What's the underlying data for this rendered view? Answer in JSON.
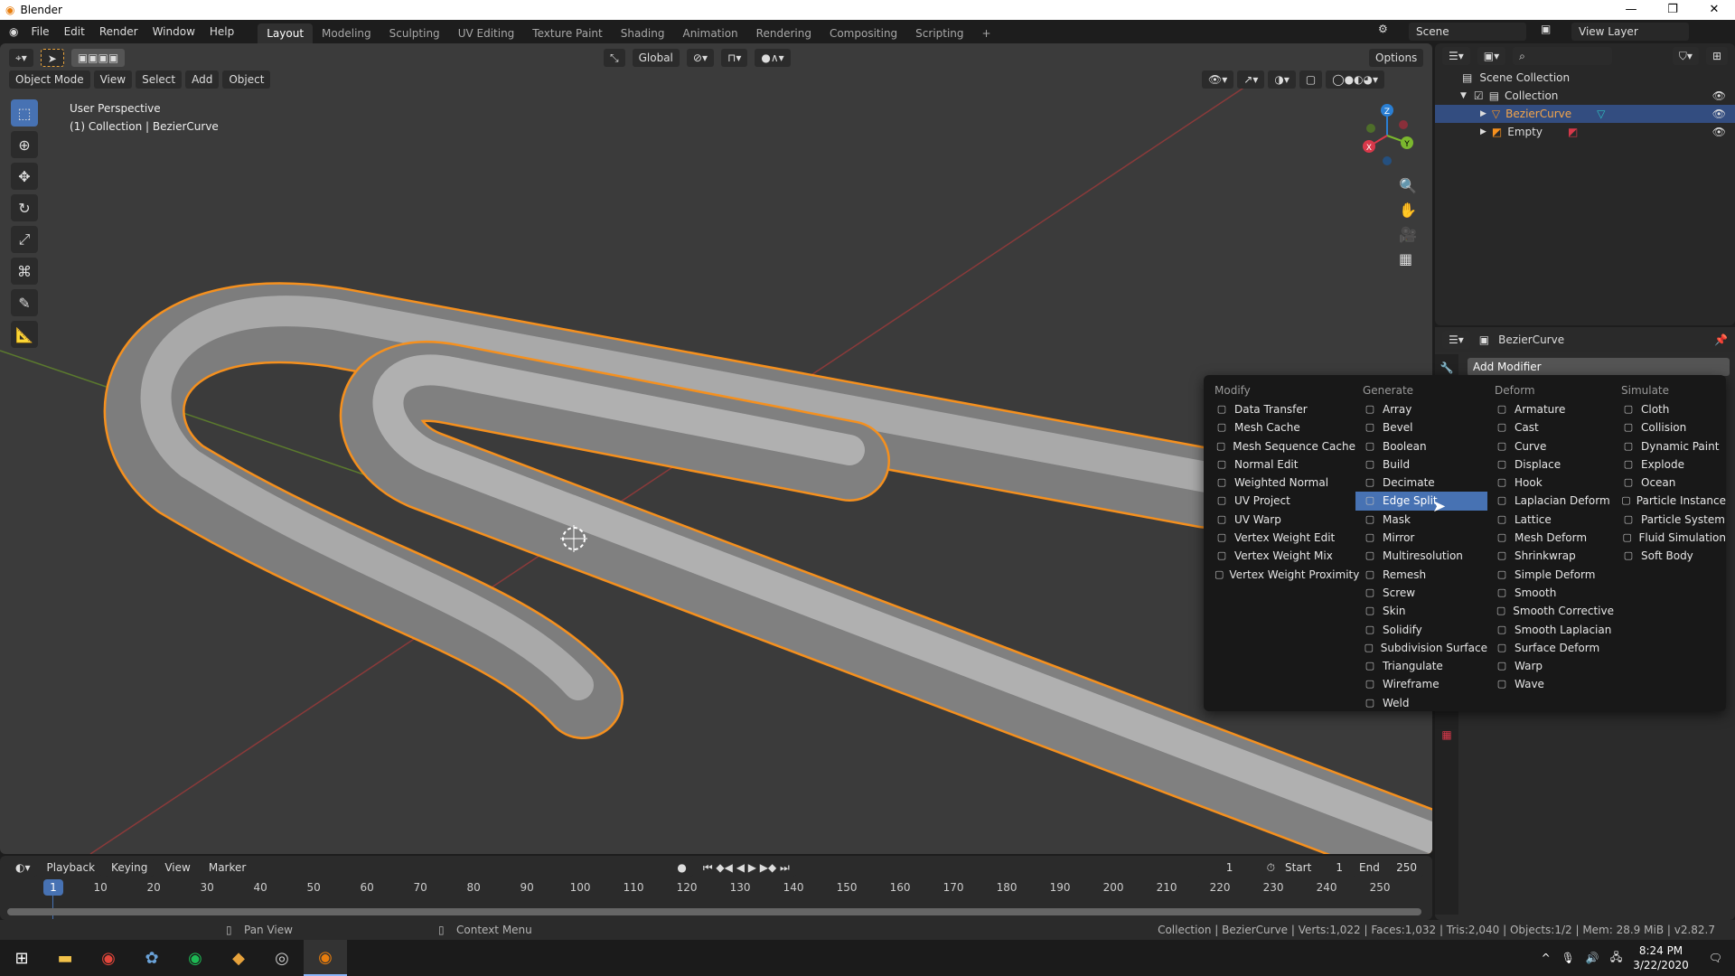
{
  "window": {
    "title": "Blender",
    "min": "—",
    "max": "❐",
    "close": "✕"
  },
  "menubar": {
    "items": [
      "File",
      "Edit",
      "Render",
      "Window",
      "Help"
    ]
  },
  "workspaces": {
    "tabs": [
      "Layout",
      "Modeling",
      "Sculpting",
      "UV Editing",
      "Texture Paint",
      "Shading",
      "Animation",
      "Rendering",
      "Compositing",
      "Scripting"
    ],
    "active": "Layout",
    "add": "+"
  },
  "scene": {
    "name": "Scene",
    "view_layer": "View Layer"
  },
  "viewport": {
    "orientation": "Global",
    "options": "Options",
    "mode": "Object Mode",
    "menus": [
      "View",
      "Select",
      "Add",
      "Object"
    ],
    "overlay_title": "User Perspective",
    "overlay_sub": "(1) Collection | BezierCurve",
    "gizmo": {
      "x": "X",
      "y": "Y",
      "z": "Z"
    }
  },
  "outliner": {
    "root": "Scene Collection",
    "collection": "Collection",
    "items": [
      {
        "name": "BezierCurve",
        "selected": true
      },
      {
        "name": "Empty",
        "selected": false
      }
    ]
  },
  "properties": {
    "object": "BezierCurve",
    "add_modifier": "Add Modifier"
  },
  "modifier_menu": {
    "columns": [
      {
        "title": "Modify",
        "items": [
          "Data Transfer",
          "Mesh Cache",
          "Mesh Sequence Cache",
          "Normal Edit",
          "Weighted Normal",
          "UV Project",
          "UV Warp",
          "Vertex Weight Edit",
          "Vertex Weight Mix",
          "Vertex Weight Proximity"
        ]
      },
      {
        "title": "Generate",
        "items": [
          "Array",
          "Bevel",
          "Boolean",
          "Build",
          "Decimate",
          "Edge Split",
          "Mask",
          "Mirror",
          "Multiresolution",
          "Remesh",
          "Screw",
          "Skin",
          "Solidify",
          "Subdivision Surface",
          "Triangulate",
          "Wireframe",
          "Weld"
        ]
      },
      {
        "title": "Deform",
        "items": [
          "Armature",
          "Cast",
          "Curve",
          "Displace",
          "Hook",
          "Laplacian Deform",
          "Lattice",
          "Mesh Deform",
          "Shrinkwrap",
          "Simple Deform",
          "Smooth",
          "Smooth Corrective",
          "Smooth Laplacian",
          "Surface Deform",
          "Warp",
          "Wave"
        ]
      },
      {
        "title": "Simulate",
        "items": [
          "Cloth",
          "Collision",
          "Dynamic Paint",
          "Explode",
          "Ocean",
          "Particle Instance",
          "Particle System",
          "Fluid Simulation",
          "Soft Body"
        ]
      }
    ],
    "highlighted": "Edge Split"
  },
  "timeline": {
    "menus": [
      "Playback",
      "Keying",
      "View",
      "Marker"
    ],
    "current_frame": "1",
    "start_label": "Start",
    "start": "1",
    "end_label": "End",
    "end": "250",
    "ticks": [
      "10",
      "20",
      "30",
      "40",
      "50",
      "60",
      "70",
      "80",
      "90",
      "100",
      "110",
      "120",
      "130",
      "140",
      "150",
      "160",
      "170",
      "180",
      "190",
      "200",
      "210",
      "220",
      "230",
      "240",
      "250"
    ]
  },
  "statusbar": {
    "pan": "Pan View",
    "context": "Context Menu",
    "info": "Collection | BezierCurve | Verts:1,022 | Faces:1,032 | Tris:2,040 | Objects:1/2 | Mem: 28.9 MiB | v2.82.7"
  },
  "taskbar": {
    "time": "8:24 PM",
    "date": "3/22/2020"
  },
  "colors": {
    "accent": "#4772b3",
    "selection": "#f5901e",
    "background": "#3b3b3b"
  }
}
